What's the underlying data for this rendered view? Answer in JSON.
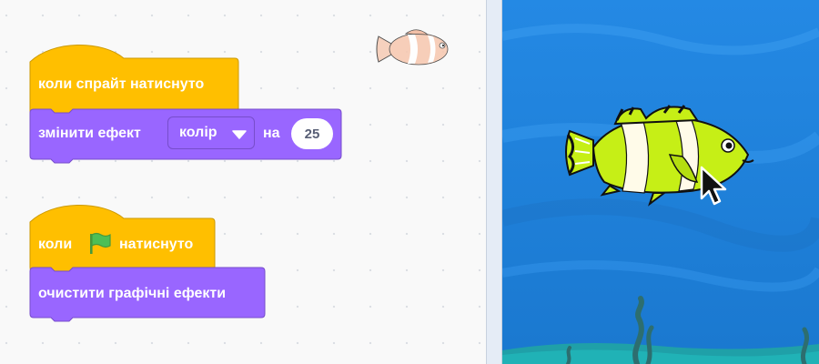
{
  "script1": {
    "hat_label": "коли спрайт натиснуто",
    "effect_prefix": "змінити ефект",
    "effect_dropdown": "колір",
    "effect_middle": "на",
    "effect_value": "25"
  },
  "script2": {
    "hat_prefix": "коли",
    "hat_suffix": "натиснуто",
    "clear_label": "очистити графічні ефекти"
  },
  "colors": {
    "events_yellow": "#ffbf00",
    "events_border": "#cc9900",
    "looks_purple": "#9966ff",
    "looks_border": "#774dcb",
    "stage_water": "#2a8be3",
    "fish_body": "#c6ef16"
  },
  "icons": [
    "green-flag-icon",
    "dropdown-arrow-icon",
    "mouse-cursor-icon",
    "clownfish-sprite-thumbnail"
  ]
}
